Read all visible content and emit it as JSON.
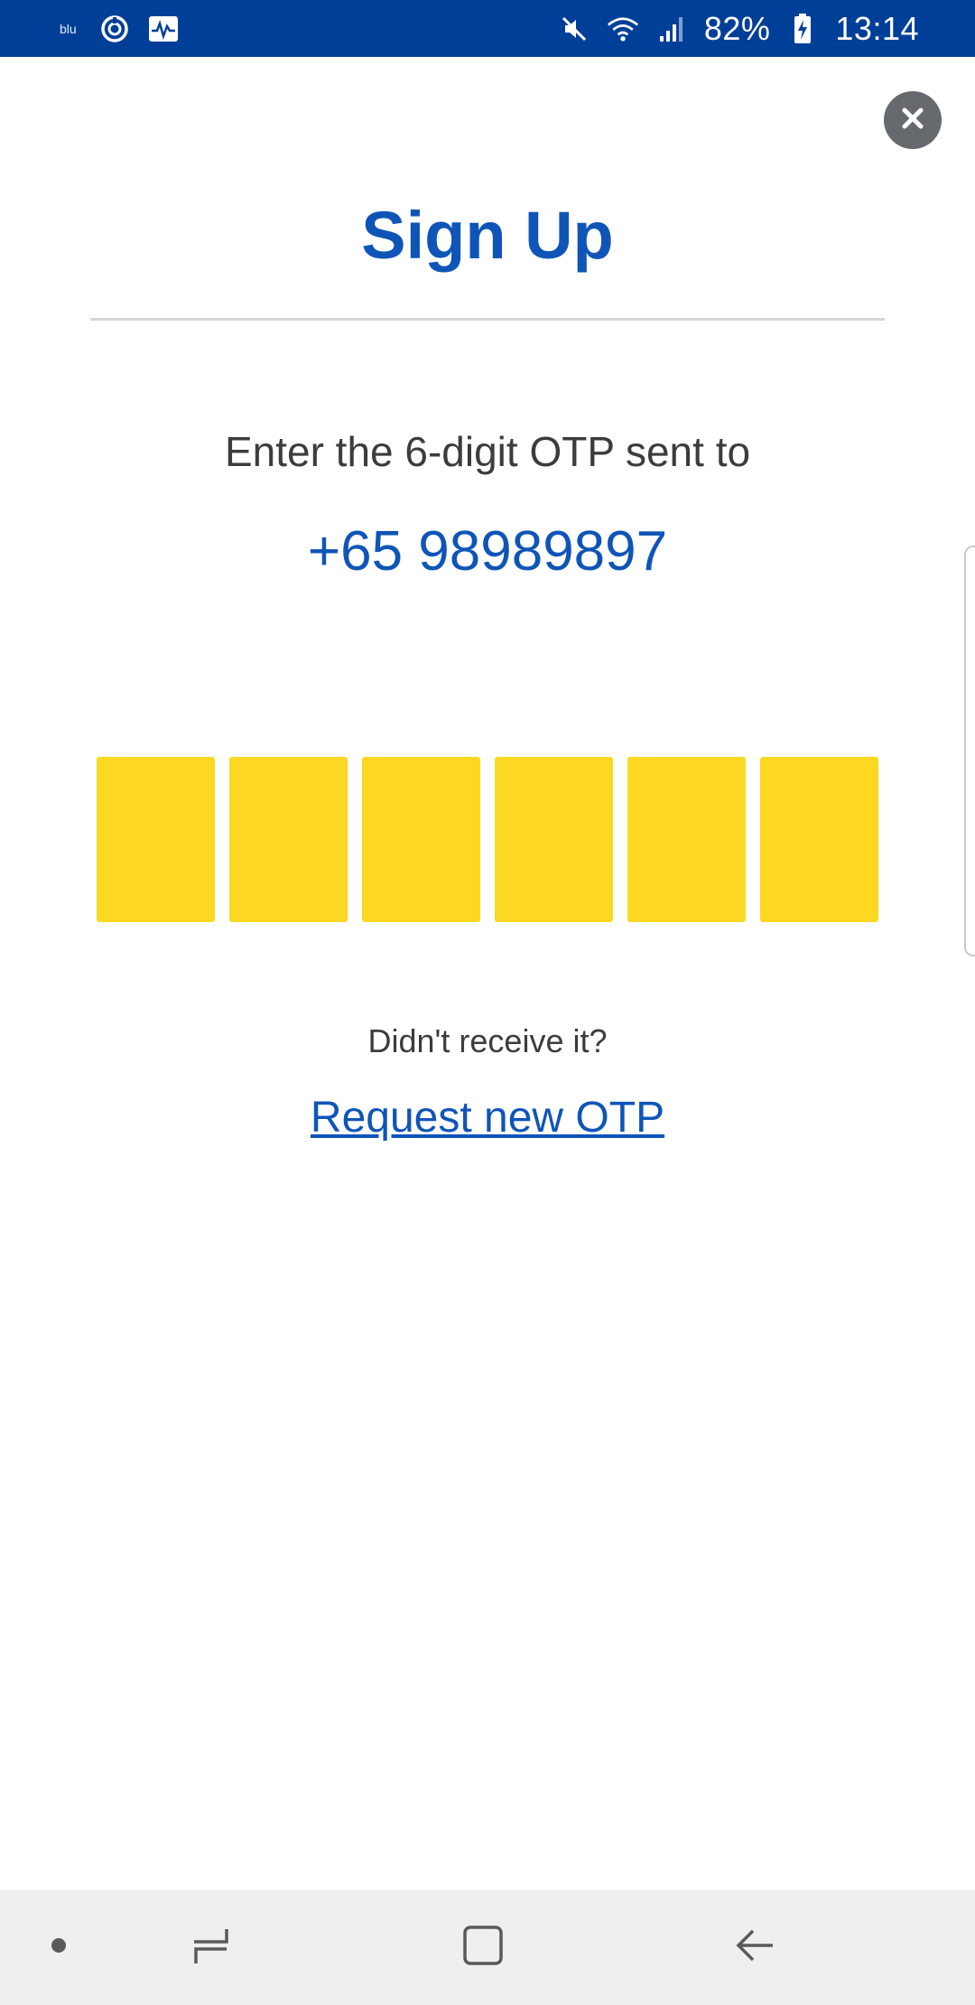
{
  "status_bar": {
    "carrier": "blu",
    "icons": [
      "sync-icon",
      "activity-icon",
      "mute-icon",
      "wifi-icon",
      "signal-icon",
      "battery-charging-icon"
    ],
    "battery": "82%",
    "time": "13:14",
    "background": "#003f98"
  },
  "dialog": {
    "title": "Sign Up",
    "instruction": "Enter the 6-digit OTP sent to",
    "phone_number": "+65 98989897",
    "otp_length": 6,
    "otp_values": [
      "",
      "",
      "",
      "",
      "",
      ""
    ],
    "didnt_receive": "Didn't receive it?",
    "request_link": "Request new OTP"
  },
  "colors": {
    "brand_blue": "#0f55b8",
    "otp_yellow": "#fcd822",
    "close_grey": "#666a6f"
  },
  "nav_bar": {
    "icons": [
      "dot-icon",
      "recents-icon",
      "home-icon",
      "back-icon"
    ]
  }
}
